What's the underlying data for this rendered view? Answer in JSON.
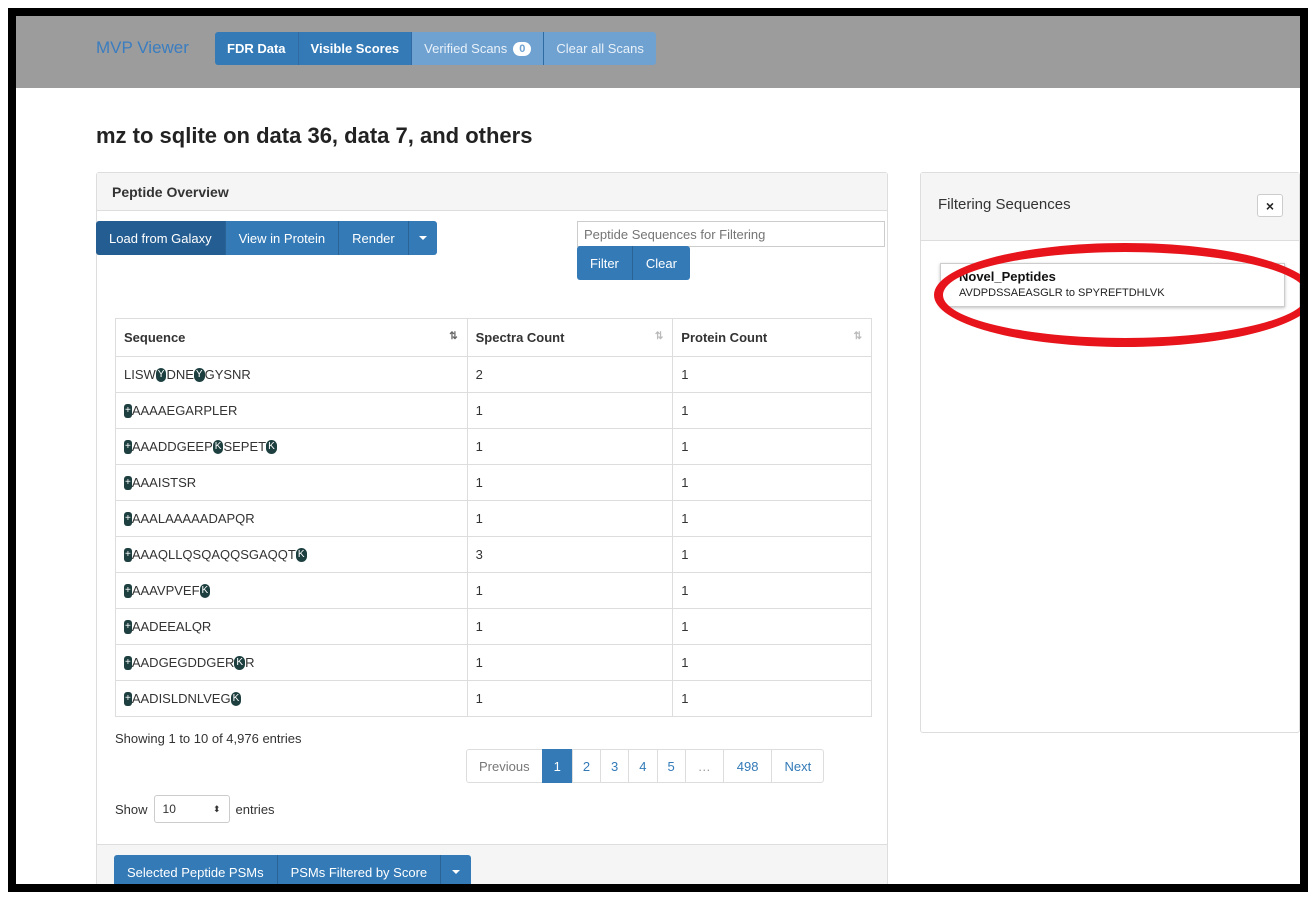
{
  "navbar": {
    "brand": "MVP Viewer",
    "buttons": [
      "FDR Data",
      "Visible Scores",
      "Verified Scans",
      "Clear all Scans"
    ],
    "verified_count": "0"
  },
  "page_title": "mz to sqlite on data 36, data 7, and others",
  "peptide_panel": {
    "title": "Peptide Overview",
    "actions": [
      "Load from Galaxy",
      "View in Protein",
      "Render"
    ],
    "filter_placeholder": "Peptide Sequences for Filtering",
    "filter_button": "Filter",
    "clear_button": "Clear",
    "columns": [
      "Sequence",
      "Spectra Count",
      "Protein Count"
    ],
    "rows": [
      {
        "segments": [
          [
            "t",
            "LISW"
          ],
          [
            "m",
            "Y"
          ],
          [
            "t",
            "DNE"
          ],
          [
            "m",
            "Y"
          ],
          [
            "t",
            "GYSNR"
          ]
        ],
        "spectra": "2",
        "proteins": "1"
      },
      {
        "segments": [
          [
            "n",
            "+"
          ],
          [
            "t",
            "AAAAEGARPLER"
          ]
        ],
        "spectra": "1",
        "proteins": "1"
      },
      {
        "segments": [
          [
            "n",
            "+"
          ],
          [
            "t",
            "AAADDGEEP"
          ],
          [
            "m",
            "K"
          ],
          [
            "t",
            "SEPET"
          ],
          [
            "m",
            "K"
          ]
        ],
        "spectra": "1",
        "proteins": "1"
      },
      {
        "segments": [
          [
            "n",
            "+"
          ],
          [
            "t",
            "AAAISTSR"
          ]
        ],
        "spectra": "1",
        "proteins": "1"
      },
      {
        "segments": [
          [
            "n",
            "+"
          ],
          [
            "t",
            "AAALAAAAADAPQR"
          ]
        ],
        "spectra": "1",
        "proteins": "1"
      },
      {
        "segments": [
          [
            "n",
            "+"
          ],
          [
            "t",
            "AAAQLLQSQAQQSGAQQT"
          ],
          [
            "m",
            "K"
          ]
        ],
        "spectra": "3",
        "proteins": "1"
      },
      {
        "segments": [
          [
            "n",
            "+"
          ],
          [
            "t",
            "AAAVPVEF"
          ],
          [
            "m",
            "K"
          ]
        ],
        "spectra": "1",
        "proteins": "1"
      },
      {
        "segments": [
          [
            "n",
            "+"
          ],
          [
            "t",
            "AADEEALQR"
          ]
        ],
        "spectra": "1",
        "proteins": "1"
      },
      {
        "segments": [
          [
            "n",
            "+"
          ],
          [
            "t",
            "AADGEGDDGER"
          ],
          [
            "m",
            "K"
          ],
          [
            "t",
            "R"
          ]
        ],
        "spectra": "1",
        "proteins": "1"
      },
      {
        "segments": [
          [
            "n",
            "+"
          ],
          [
            "t",
            "AADISLDNLVEG"
          ],
          [
            "m",
            "K"
          ]
        ],
        "spectra": "1",
        "proteins": "1"
      }
    ],
    "info": "Showing 1 to 10 of 4,976 entries",
    "pagination": {
      "previous": "Previous",
      "pages": [
        "1",
        "2",
        "3",
        "4",
        "5",
        "…",
        "498"
      ],
      "current": "1",
      "next": "Next"
    },
    "length": {
      "show": "Show",
      "value": "10",
      "entries": "entries"
    },
    "footer_actions": [
      "Selected Peptide PSMs",
      "PSMs Filtered by Score"
    ]
  },
  "filter_panel": {
    "title": "Filtering Sequences",
    "close": "×",
    "item_name": "Novel_Peptides",
    "item_range": "AVDPDSSAEASGLR to SPYREFTDHLVK"
  },
  "colors": {
    "primary": "#337ab7",
    "navbar": "#9c9c9c",
    "highlight": "#e8141c",
    "mod_badge": "#1d3f3f"
  },
  "icons": [
    "sort-icon",
    "caret-down-icon",
    "close-icon",
    "select-arrows-icon"
  ]
}
